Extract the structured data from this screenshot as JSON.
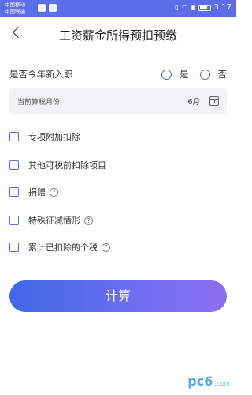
{
  "status": {
    "carrier_line1": "中国移动",
    "carrier_line2": "中国联通",
    "time": "3:17"
  },
  "header": {
    "title": "工资薪金所得预扣预缴"
  },
  "newhire": {
    "question": "是否今年新入职",
    "yes": "是",
    "no": "否"
  },
  "month": {
    "label": "当前算税月份",
    "value": "6月"
  },
  "checks": [
    {
      "label": "专项附加扣除",
      "help": false
    },
    {
      "label": "其他可税前扣除项目",
      "help": false
    },
    {
      "label": "捐赠",
      "help": true
    },
    {
      "label": "特殊征减情形",
      "help": true
    },
    {
      "label": "累计已扣除的个税",
      "help": true
    }
  ],
  "button": {
    "label": "计算"
  },
  "watermark": {
    "main": "pc6",
    "sub": ".com"
  },
  "colors": {
    "accent": "#5b6ee8",
    "button_start": "#3f67e6",
    "button_end": "#8a6ff0"
  }
}
